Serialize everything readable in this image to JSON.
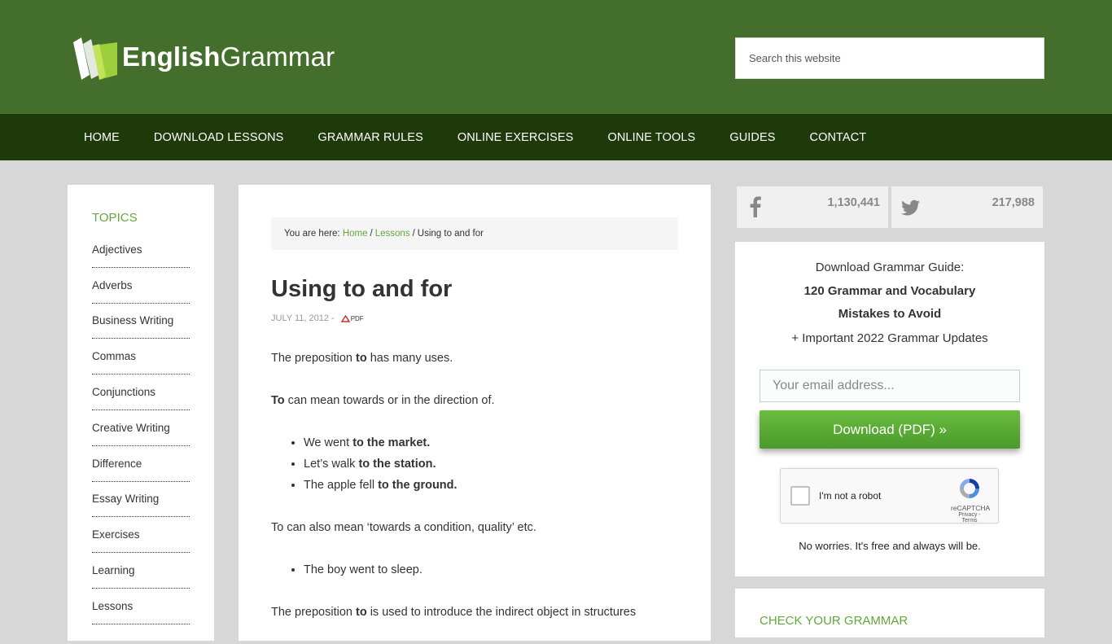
{
  "logo": {
    "text_bold": "English",
    "text_regular": "Grammar"
  },
  "search": {
    "placeholder": "Search this website"
  },
  "nav": {
    "items": [
      {
        "label": "HOME"
      },
      {
        "label": "DOWNLOAD LESSONS"
      },
      {
        "label": "GRAMMAR RULES"
      },
      {
        "label": "ONLINE EXERCISES"
      },
      {
        "label": "ONLINE TOOLS"
      },
      {
        "label": "GUIDES"
      },
      {
        "label": "CONTACT"
      }
    ]
  },
  "topics": {
    "title": "TOPICS",
    "items": [
      {
        "label": "Adjectives"
      },
      {
        "label": "Adverbs"
      },
      {
        "label": "Business Writing"
      },
      {
        "label": "Commas"
      },
      {
        "label": "Conjunctions"
      },
      {
        "label": "Creative Writing"
      },
      {
        "label": "Difference"
      },
      {
        "label": "Essay Writing"
      },
      {
        "label": "Exercises"
      },
      {
        "label": "Learning"
      },
      {
        "label": "Lessons"
      }
    ]
  },
  "breadcrumb": {
    "prefix": "You are here:",
    "home": "Home",
    "lessons": "Lessons",
    "current": "Using to and for",
    "separator": "/"
  },
  "post": {
    "title": "Using to and for",
    "date": "JULY 11, 2012",
    "meta_separator": "-",
    "pdf_label": "PDF"
  },
  "content": {
    "p1_before": "The preposition ",
    "p1_bold": "to",
    "p1_after": " has many uses.",
    "p2_bold": "To",
    "p2_after": " can mean towards or in the direction of.",
    "list1": [
      {
        "before": "We went ",
        "bold": "to the market."
      },
      {
        "before": "Let’s walk ",
        "bold": "to the station."
      },
      {
        "before": "The apple fell ",
        "bold": "to the ground."
      }
    ],
    "p3": "To can also mean ‘towards a condition, quality’ etc.",
    "list2": [
      {
        "text": "The boy went to sleep."
      }
    ],
    "p4_before": "The preposition ",
    "p4_bold": "to",
    "p4_after": " is used to introduce the indirect object in structures"
  },
  "social": {
    "facebook_count": "1,130,441",
    "twitter_count": "217,988",
    "facebook_icon": "facebook-icon",
    "twitter_icon": "twitter-icon"
  },
  "optin": {
    "line1": "Download Grammar Guide:",
    "line2": "120 Grammar and Vocabulary",
    "line3": "Mistakes to Avoid",
    "line4": "+ Important 2022 Grammar Updates",
    "email_placeholder": "Your email address...",
    "button_label": "Download (PDF) »",
    "recaptcha_label": "I'm not a robot",
    "recaptcha_brand": "reCAPTCHA",
    "recaptcha_links": "Privacy - Terms",
    "footnote": "No worries. It's free and always will be."
  },
  "check_widget": {
    "title": "CHECK YOUR GRAMMAR"
  },
  "colors": {
    "header": "#446e2c",
    "nav": "#1e3a0b",
    "accent": "#64a53c",
    "button": "#5aac34",
    "background": "#d7d7d7"
  }
}
